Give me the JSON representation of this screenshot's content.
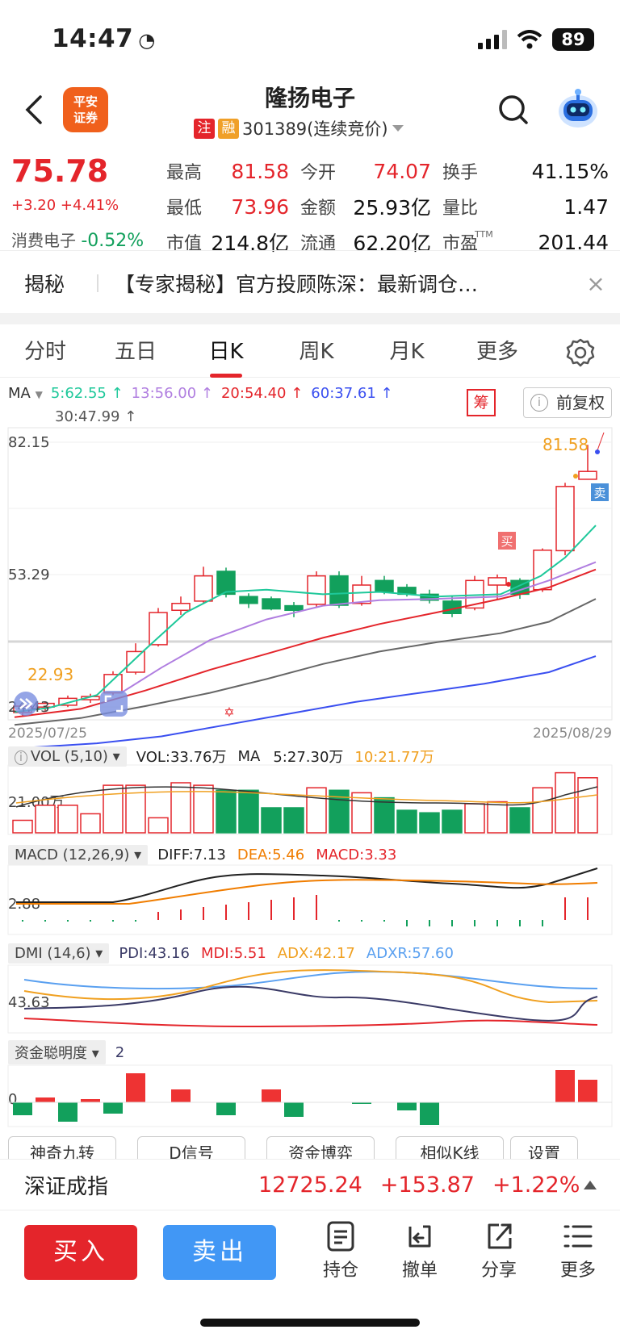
{
  "status": {
    "time": "14:47",
    "battery": "89"
  },
  "header": {
    "title": "隆扬电子",
    "broker_logo": "平安证券",
    "tag_zhu": "注",
    "tag_rong": "融",
    "code": "301389(连续竞价)",
    "icons": [
      "back-icon",
      "search-icon",
      "robot-icon",
      "chevron-down-icon"
    ]
  },
  "quote": {
    "price": "75.78",
    "change": "+3.20 +4.41%",
    "sector_name": "消费电子",
    "sector_change": "-0.52%",
    "rows": [
      [
        {
          "label": "最高",
          "value": "81.58",
          "color": "red"
        },
        {
          "label": "今开",
          "value": "74.07",
          "color": "red"
        },
        {
          "label": "换手",
          "value": "41.15%",
          "color": "black"
        }
      ],
      [
        {
          "label": "最低",
          "value": "73.96",
          "color": "red"
        },
        {
          "label": "金额",
          "value": "25.93亿",
          "color": "black"
        },
        {
          "label": "量比",
          "value": "1.47",
          "color": "black"
        }
      ],
      [
        {
          "label": "市值",
          "value": "214.8亿",
          "color": "black"
        },
        {
          "label": "流通",
          "value": "62.20亿",
          "color": "black"
        },
        {
          "label": "市盈",
          "value": "201.44",
          "color": "black",
          "sup": "TTM"
        }
      ]
    ]
  },
  "news": {
    "tag": "揭秘",
    "text": "【专家揭秘】官方投顾陈深：最新调仓…",
    "close": "×"
  },
  "tabs": [
    "分时",
    "五日",
    "日K",
    "周K",
    "月K",
    "更多"
  ],
  "active_tab": "日K",
  "ma": {
    "label": "MA",
    "items": [
      {
        "text": "5:62.55 ↑",
        "color": "#1ec89a"
      },
      {
        "text": "13:56.00 ↑",
        "color": "#b07ee0"
      },
      {
        "text": "20:54.40 ↑",
        "color": "#e4252b"
      },
      {
        "text": "60:37.61 ↑",
        "color": "#3a4ff0"
      },
      {
        "text": "30:47.99 ↑",
        "color": "#555555"
      }
    ],
    "chou": "筹",
    "fuquan": "前复权",
    "info_i": "i"
  },
  "kchart": {
    "y_top": "82.15",
    "y_mid": "53.29",
    "y_bot": "24.43",
    "date_start": "2025/07/25",
    "date_end": "2025/08/29",
    "high_label": "81.58",
    "low_label": "22.93",
    "buy_mark": "买",
    "sell_mark": "卖"
  },
  "vol": {
    "name": "VOL (5,10)",
    "vol": "VOL:33.76万",
    "ma": "MA",
    "ma5": "5:27.30万",
    "ma10": "10:21.77万",
    "axis": "21.00万"
  },
  "macd": {
    "name": "MACD (12,26,9)",
    "diff": "DIFF:7.13",
    "dea": "DEA:5.46",
    "macd": "MACD:3.33",
    "axis": "2.88"
  },
  "dmi": {
    "name": "DMI (14,6)",
    "pdi": "PDI:43.16",
    "mdi": "MDI:5.51",
    "adx": "ADX:42.17",
    "adxr": "ADXR:57.60",
    "axis": "43.63"
  },
  "fund": {
    "name": "资金聪明度",
    "value": "2",
    "axis": "0"
  },
  "tools": [
    "神奇九转",
    "D信号",
    "资金博弈",
    "相似K线",
    "设置"
  ],
  "index_bar": {
    "name": "深证成指",
    "value": "12725.24",
    "change": "+153.87",
    "pct": "+1.22%"
  },
  "bottom": {
    "buy": "买入",
    "sell": "卖出",
    "hold": "持仓",
    "cancel": "撤单",
    "share": "分享",
    "more": "更多"
  },
  "colors": {
    "up": "#e4252b",
    "down": "#12a05c",
    "ma5": "#1ec89a",
    "ma13": "#b07ee0",
    "ma20": "#e4252b",
    "ma30": "#666666",
    "ma60": "#3a4ff0",
    "sell_btn": "#4197f5"
  }
}
